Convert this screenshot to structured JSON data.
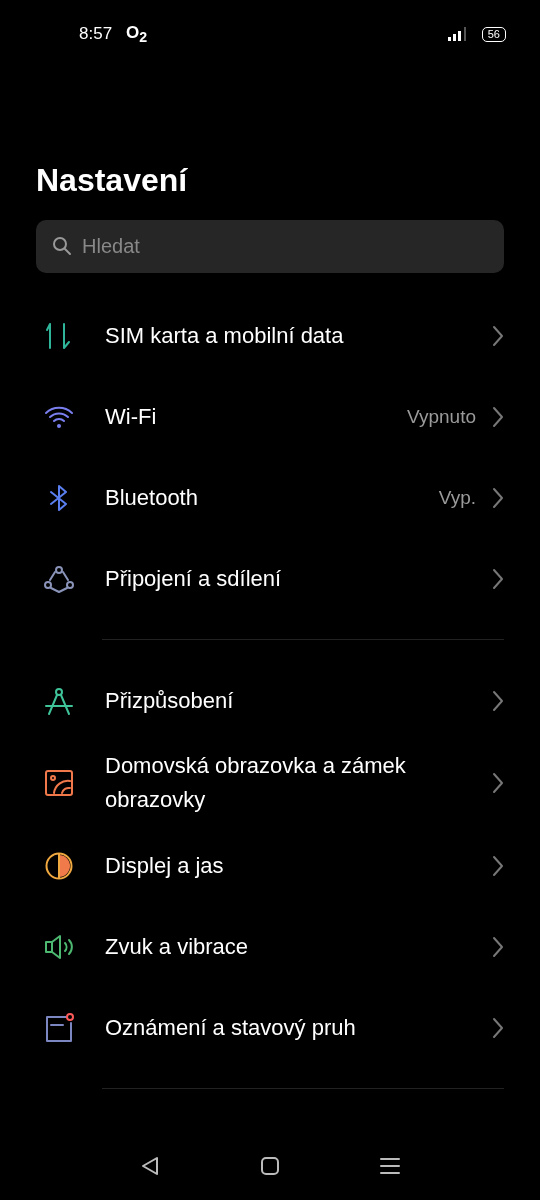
{
  "status_bar": {
    "time": "8:57",
    "carrier": "O$_{2}$",
    "battery": "56"
  },
  "title": "Nastavení",
  "search": {
    "placeholder": "Hledat"
  },
  "sections": [
    {
      "items": [
        {
          "label": "SIM karta a mobilní data"
        },
        {
          "label": "Wi-Fi",
          "value": "Vypnuto"
        },
        {
          "label": "Bluetooth",
          "value": "Vyp."
        },
        {
          "label": "Připojení a sdílení"
        }
      ]
    },
    {
      "items": [
        {
          "label": "Přizpůsobení"
        },
        {
          "label": "Domovská obrazovka a zámek obrazovky"
        },
        {
          "label": "Displej a jas"
        },
        {
          "label": "Zvuk a vibrace"
        },
        {
          "label": "Oznámení a stavový pruh"
        }
      ]
    }
  ]
}
